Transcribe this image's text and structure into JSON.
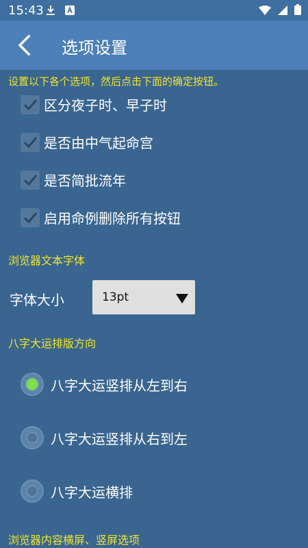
{
  "status": {
    "time": "15:43",
    "left_icons": [
      "download-icon",
      "a-box-icon"
    ],
    "right_icons": [
      "wifi-icon",
      "signal-icon",
      "battery-icon"
    ]
  },
  "appbar": {
    "title": "选项设置",
    "back_icon": "chevron-left-icon"
  },
  "content": {
    "hint": "设置以下各个选项，然后点击下面的确定按钮。",
    "checkboxes": [
      {
        "label": "区分夜子时、早子时",
        "checked": true
      },
      {
        "label": "是否由中气起命宫",
        "checked": true
      },
      {
        "label": "是否简批流年",
        "checked": true
      },
      {
        "label": "启用命例删除所有按钮",
        "checked": true
      }
    ],
    "section_font": "浏览器文本字体",
    "font_size_label": "字体大小",
    "font_size_value": "13pt",
    "section_direction": "八字大运排版方向",
    "radios": [
      {
        "label": "八字大运竖排从左到右",
        "selected": true
      },
      {
        "label": "八字大运竖排从右到左",
        "selected": false
      },
      {
        "label": "八字大运横排",
        "selected": false
      }
    ],
    "section_orientation": "浏览器内容横屏、竖屏选项"
  },
  "colors": {
    "background": "#3a6590",
    "appbar": "#4d7fb8",
    "accent_text": "#f0e62a",
    "radio_selected": "#7ee04a"
  }
}
